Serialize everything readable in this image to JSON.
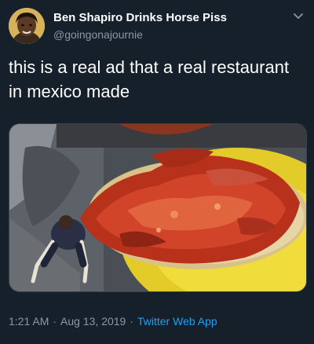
{
  "author": {
    "display_name": "Ben Shapiro Drinks Horse Piss",
    "handle": "@goingonajournie"
  },
  "tweet": {
    "text": "this is a real ad that a real restaurant in mexico made"
  },
  "meta": {
    "time": "1:21 AM",
    "separator": "·",
    "date": "Aug 13, 2019",
    "source": "Twitter Web App"
  },
  "icons": {
    "menu": "chevron-down-icon",
    "avatar": "profile-photo"
  },
  "colors": {
    "background": "#15202b",
    "secondary_text": "#8899a6",
    "link": "#1da1f2",
    "border": "#38444d"
  }
}
